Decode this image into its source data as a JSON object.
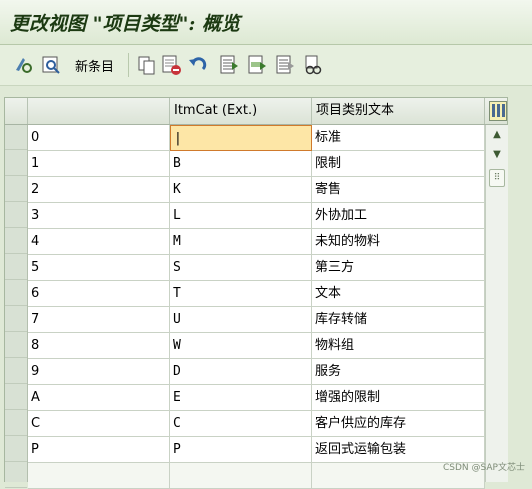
{
  "title": "更改视图 \"项目类型\": 概览",
  "toolbar": {
    "new_entries_label": "新条目",
    "icons": [
      "change-display-icon",
      "details-icon",
      "copy-icon",
      "delete-icon",
      "undo-icon",
      "select-all-icon",
      "select-block-icon",
      "deselect-all-icon",
      "print-icon"
    ]
  },
  "table": {
    "columns": [
      "",
      "ItmCat (Ext.)",
      "项目类别文本"
    ],
    "rows": [
      {
        "key": "0",
        "ext": "",
        "text": "标准"
      },
      {
        "key": "1",
        "ext": "B",
        "text": "限制"
      },
      {
        "key": "2",
        "ext": "K",
        "text": "寄售"
      },
      {
        "key": "3",
        "ext": "L",
        "text": "外协加工"
      },
      {
        "key": "4",
        "ext": "M",
        "text": "未知的物料"
      },
      {
        "key": "5",
        "ext": "S",
        "text": "第三方"
      },
      {
        "key": "6",
        "ext": "T",
        "text": "文本"
      },
      {
        "key": "7",
        "ext": "U",
        "text": "库存转储"
      },
      {
        "key": "8",
        "ext": "W",
        "text": "物料组"
      },
      {
        "key": "9",
        "ext": "D",
        "text": "服务"
      },
      {
        "key": "A",
        "ext": "E",
        "text": "增强的限制"
      },
      {
        "key": "C",
        "ext": "C",
        "text": "客户供应的库存"
      },
      {
        "key": "P",
        "ext": "P",
        "text": "返回式运输包装"
      }
    ]
  },
  "watermark": "CSDN @SAP文芯士",
  "colors": {
    "accent": "#1c3a12",
    "focus_fill": "#fde6a6",
    "focus_border": "#d07a2c"
  }
}
